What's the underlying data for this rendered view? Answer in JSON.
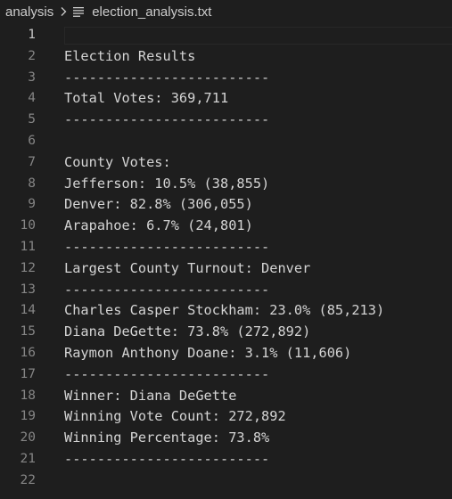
{
  "breadcrumb": {
    "folder": "analysis",
    "separator_icon": "chevron-right-icon",
    "file_icon": "text-file-icon",
    "file": "election_analysis.txt"
  },
  "editor": {
    "active_line": 1,
    "lines": [
      {
        "number": "1",
        "text": ""
      },
      {
        "number": "2",
        "text": "Election Results"
      },
      {
        "number": "3",
        "text": "-------------------------"
      },
      {
        "number": "4",
        "text": "Total Votes: 369,711"
      },
      {
        "number": "5",
        "text": "-------------------------"
      },
      {
        "number": "6",
        "text": ""
      },
      {
        "number": "7",
        "text": "County Votes:"
      },
      {
        "number": "8",
        "text": "Jefferson: 10.5% (38,855)"
      },
      {
        "number": "9",
        "text": "Denver: 82.8% (306,055)"
      },
      {
        "number": "10",
        "text": "Arapahoe: 6.7% (24,801)"
      },
      {
        "number": "11",
        "text": "-------------------------"
      },
      {
        "number": "12",
        "text": "Largest County Turnout: Denver"
      },
      {
        "number": "13",
        "text": "-------------------------"
      },
      {
        "number": "14",
        "text": "Charles Casper Stockham: 23.0% (85,213)"
      },
      {
        "number": "15",
        "text": "Diana DeGette: 73.8% (272,892)"
      },
      {
        "number": "16",
        "text": "Raymon Anthony Doane: 3.1% (11,606)"
      },
      {
        "number": "17",
        "text": "-------------------------"
      },
      {
        "number": "18",
        "text": "Winner: Diana DeGette"
      },
      {
        "number": "19",
        "text": "Winning Vote Count: 272,892"
      },
      {
        "number": "20",
        "text": "Winning Percentage: 73.8%"
      },
      {
        "number": "21",
        "text": "-------------------------"
      },
      {
        "number": "22",
        "text": ""
      }
    ]
  },
  "colors": {
    "background": "#1e1e1e",
    "text": "#d4d4d4",
    "line_number": "#858585",
    "active_line_number": "#c6c6c6"
  }
}
